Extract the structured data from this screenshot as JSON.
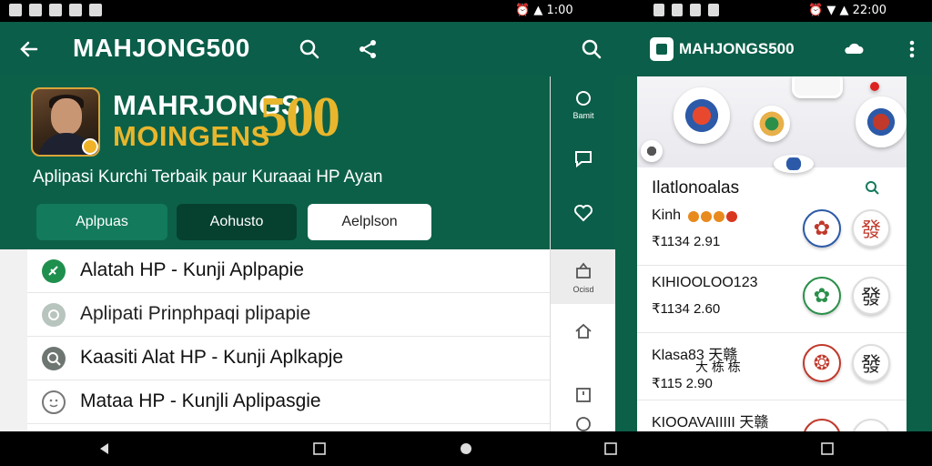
{
  "status_bar": {
    "time_left": "1:00",
    "time_right": "22:00"
  },
  "left_app": {
    "title": "MAHJONG500",
    "icons": [
      "back-arrow-icon",
      "search-icon",
      "share-icon",
      "search-icon"
    ],
    "hero": {
      "title_line1": "MAHRJONGS",
      "title_line2": "MOINGENS",
      "title_big": "500",
      "subtitle": "Aplipasi Kurchi Terbaik paur Kuraaai HP Ayan",
      "tabs": [
        "Aplpuas",
        "Aohusto",
        "Aelplson"
      ]
    },
    "list": [
      {
        "icon": "green-circle-icon",
        "label": "Alatah HP - Kunji Aplpapie"
      },
      {
        "icon": "gear-circle-icon",
        "label": "Aplipati Prinphpaqi plipapie"
      },
      {
        "icon": "search-circle-icon",
        "label": "Kaasiti Alat HP - Kunji Aplkapje"
      },
      {
        "icon": "smiley-icon",
        "label": "Mataa HP - Kunjli Aplipasgie"
      }
    ]
  },
  "rail": {
    "items": [
      {
        "icon": "home-circle-icon",
        "label": "Bamit"
      },
      {
        "icon": "chat-bubble-icon",
        "label": ""
      },
      {
        "icon": "heart-icon",
        "label": ""
      },
      {
        "icon": "box-icon",
        "label": "Ocisd"
      },
      {
        "icon": "house-icon",
        "label": ""
      },
      {
        "icon": "calendar-icon",
        "label": ""
      },
      {
        "icon": "profile-icon",
        "label": ""
      }
    ]
  },
  "right_app": {
    "title": "MAHJONGS500",
    "icons": [
      "logo-icon",
      "cloud-icon",
      "more-vert-icon"
    ],
    "heading": "Ilatlonoalas",
    "heading_icon": "search-icon",
    "rows": [
      {
        "name": "Kinh",
        "price": "₹1134 2.91",
        "tiles": [
          "flower-tile",
          "發"
        ]
      },
      {
        "name": "KIHIOOLOO123",
        "price": "₹1134 2.60",
        "tiles": [
          "flower-tile",
          "發"
        ]
      },
      {
        "name": "Klasa83 天赣",
        "name2": "大 栋 栋",
        "price": "₹115 2.90",
        "tiles": [
          "dragon-tile",
          "發"
        ]
      },
      {
        "name": "KIOOAVAIIIII 天赣",
        "price": "",
        "tiles": [
          "red-tile",
          "white-tile"
        ]
      }
    ]
  },
  "nav_bar": {
    "buttons": [
      "back-triangle-icon",
      "recents-square-icon",
      "home-circle-icon",
      "recents-square-icon",
      "recents-square-icon"
    ]
  },
  "colors": {
    "primary": "#0b5e49",
    "hero": "#0c6048",
    "accent_gold": "#e8b62c",
    "tab_light": "#137a5c",
    "tab_dark": "#06402f"
  }
}
